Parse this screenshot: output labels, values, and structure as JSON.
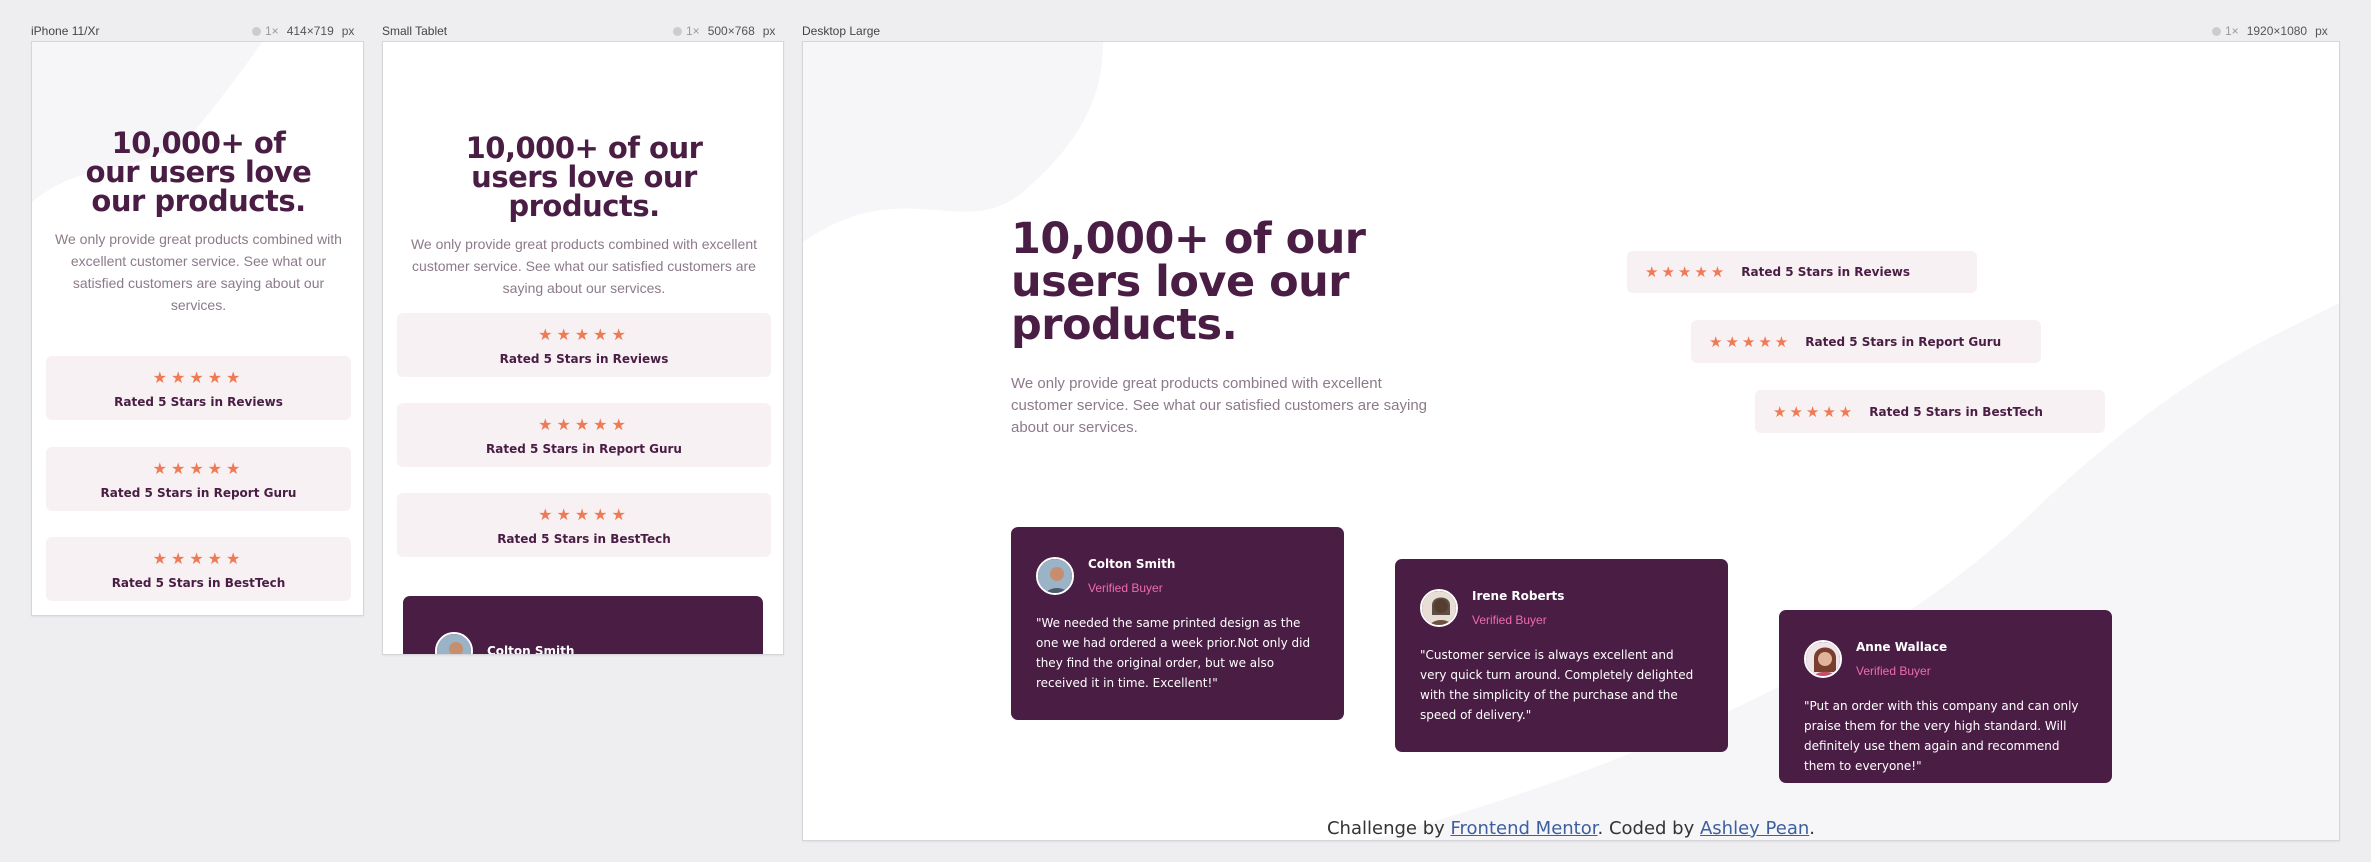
{
  "frames": {
    "phone": {
      "label": "iPhone 11/Xr",
      "zoom": "1×",
      "size": "414×719",
      "unit": "px"
    },
    "tablet": {
      "label": "Small Tablet",
      "zoom": "1×",
      "size": "500×768",
      "unit": "px"
    },
    "desktop": {
      "label": "Desktop Large",
      "zoom": "1×",
      "size": "1920×1080",
      "unit": "px"
    }
  },
  "content": {
    "title": "10,000+ of our users love our products.",
    "description": "We only provide great products combined with excellent customer service. See what our satisfied customers are saying about our services.",
    "stars": "★★★★★",
    "ratings": [
      {
        "label": "Rated 5 Stars in Reviews"
      },
      {
        "label": "Rated 5 Stars in Report Guru"
      },
      {
        "label": "Rated 5 Stars in BestTech"
      }
    ],
    "testimonials": [
      {
        "name": "Colton Smith",
        "role": "Verified Buyer",
        "quote": "\"We needed the same printed design as the one we had ordered a week prior.Not only did they find the original order, but we also received it in time. Excellent!\""
      },
      {
        "name": "Irene Roberts",
        "role": "Verified Buyer",
        "quote": "\"Customer service is always excellent and very quick turn around. Completely delighted with the simplicity of the purchase and the speed of delivery.\""
      },
      {
        "name": "Anne Wallace",
        "role": "Verified Buyer",
        "quote": "\"Put an order with this company and can only praise them for the very high standard. Will definitely use them again and recommend them to everyone!\""
      }
    ]
  },
  "attribution": {
    "prefix": "Challenge by ",
    "link1": "Frontend Mentor",
    "middle": ". Coded by ",
    "link2": "Ashley Pean",
    "suffix": "."
  },
  "colors": {
    "brand": "#4a1d44",
    "star": "#ee7b55",
    "accent_pink": "#ee6bb4",
    "rating_bg": "#f7f1f3",
    "muted_text": "#8c7a8a"
  },
  "icons": {
    "star": "star-icon",
    "avatar": "avatar-photo"
  }
}
